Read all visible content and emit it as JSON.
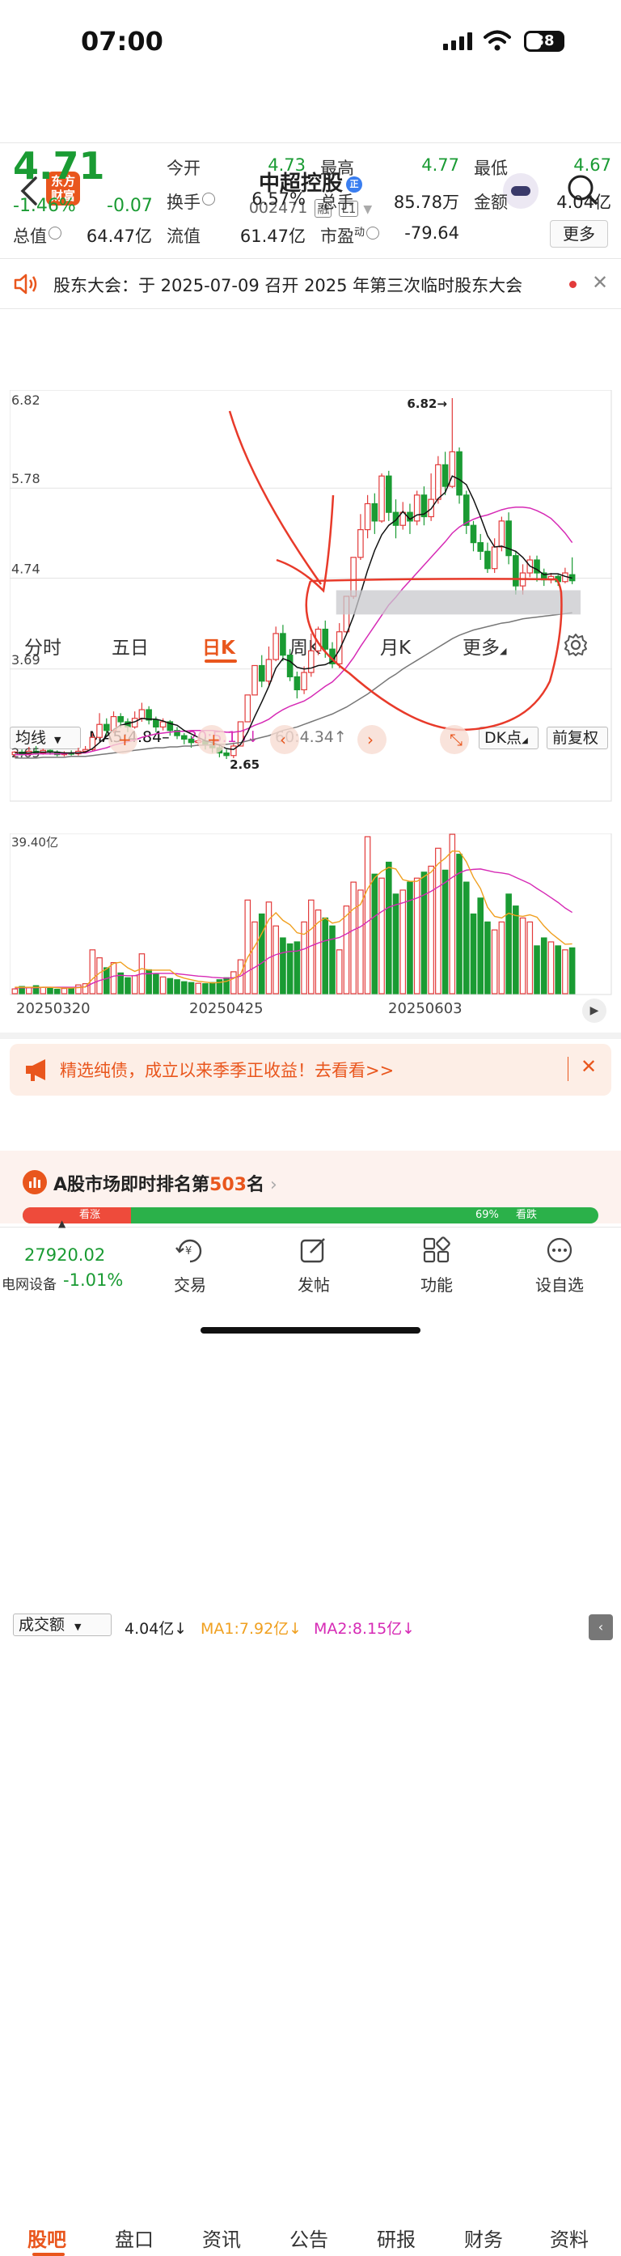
{
  "status_bar": {
    "time": "07:00",
    "battery": "38"
  },
  "header": {
    "logo_text": "东方财富",
    "title": "中超控股",
    "title_badge": "正",
    "code": "002471",
    "tags": [
      "融",
      "L1"
    ]
  },
  "quote": {
    "price": "4.71",
    "change_pct": "-1.46%",
    "change": "-0.07",
    "fields": {
      "open_label": "今开",
      "open": "4.73",
      "high_label": "最高",
      "high": "4.77",
      "low_label": "最低",
      "low": "4.67",
      "turnover_label": "换手",
      "turnover": "6.57%",
      "volume_label": "总手",
      "volume": "85.78万",
      "amount_label": "金额",
      "amount": "4.04亿",
      "mktcap_label": "总值",
      "mktcap": "64.47亿",
      "float_label": "流值",
      "float": "61.47亿",
      "pe_label": "市盈",
      "pe_sup": "动",
      "pe": "-79.64"
    },
    "more_button": "更多"
  },
  "notice": {
    "text": "股东大会：于 2025-07-09 召开 2025 年第三次临时股东大会"
  },
  "chart_tabs": [
    "分时",
    "五日",
    "日K",
    "周K",
    "月K",
    "更多"
  ],
  "active_chart_tab": "日K",
  "indicator_bar": {
    "selector": "均线",
    "ma5": "MA5:4.84–",
    "ma20": "20:5.15↓",
    "ma60": "60:4.34↑",
    "dk": "DK点",
    "adjust": "前复权"
  },
  "volume_bar": {
    "selector": "成交额",
    "value": "4.04亿↓",
    "ma1": "MA1:7.92亿↓",
    "ma2": "MA2:8.15亿↓"
  },
  "colors": {
    "up": "#e23b3b",
    "down": "#1a9b33",
    "accent": "#e9561d",
    "ma5": "#111111",
    "ma20": "#d62ab5",
    "ma60": "#777777",
    "vol_ma1": "#f0a020"
  },
  "chart_data": {
    "type": "candlestick",
    "y_ticks": [
      "6.82",
      "5.78",
      "4.74",
      "3.69",
      "2.65"
    ],
    "ylim": [
      2.65,
      6.82
    ],
    "high_marker": "6.82→",
    "low_marker": "2.65",
    "candles": [
      [
        2.7,
        2.73,
        2.67,
        2.74
      ],
      [
        2.73,
        2.71,
        2.68,
        2.76
      ],
      [
        2.71,
        2.74,
        2.69,
        2.79
      ],
      [
        2.74,
        2.72,
        2.7,
        2.8
      ],
      [
        2.72,
        2.75,
        2.7,
        2.77
      ],
      [
        2.75,
        2.73,
        2.7,
        2.76
      ],
      [
        2.73,
        2.7,
        2.68,
        2.75
      ],
      [
        2.7,
        2.72,
        2.68,
        2.74
      ],
      [
        2.72,
        2.71,
        2.69,
        2.75
      ],
      [
        2.71,
        2.74,
        2.69,
        2.78
      ],
      [
        2.74,
        2.76,
        2.72,
        2.8
      ],
      [
        2.76,
        2.9,
        2.74,
        2.95
      ],
      [
        2.9,
        3.05,
        2.88,
        3.18
      ],
      [
        3.05,
        2.98,
        2.92,
        3.12
      ],
      [
        2.98,
        3.14,
        2.95,
        3.2
      ],
      [
        3.14,
        3.08,
        3.01,
        3.18
      ],
      [
        3.08,
        3.02,
        2.96,
        3.12
      ],
      [
        3.02,
        3.12,
        3.0,
        3.2
      ],
      [
        3.12,
        3.22,
        3.08,
        3.3
      ],
      [
        3.22,
        3.1,
        3.05,
        3.26
      ],
      [
        3.1,
        3.02,
        2.96,
        3.14
      ],
      [
        3.02,
        3.08,
        2.98,
        3.12
      ],
      [
        3.08,
        2.98,
        2.92,
        3.1
      ],
      [
        2.98,
        2.92,
        2.88,
        3.02
      ],
      [
        2.92,
        2.88,
        2.82,
        2.95
      ],
      [
        2.88,
        2.84,
        2.78,
        2.92
      ],
      [
        2.84,
        2.86,
        2.8,
        2.9
      ],
      [
        2.86,
        2.82,
        2.76,
        2.9
      ],
      [
        2.82,
        2.78,
        2.72,
        2.86
      ],
      [
        2.78,
        2.72,
        2.67,
        2.82
      ],
      [
        2.72,
        2.69,
        2.65,
        2.76
      ],
      [
        2.69,
        2.8,
        2.66,
        2.84
      ],
      [
        2.8,
        3.08,
        2.8,
        3.08
      ],
      [
        3.08,
        3.39,
        3.08,
        3.39
      ],
      [
        3.39,
        3.73,
        3.39,
        3.73
      ],
      [
        3.73,
        3.55,
        3.48,
        3.85
      ],
      [
        3.55,
        3.8,
        3.5,
        3.95
      ],
      [
        3.8,
        4.1,
        3.78,
        4.18
      ],
      [
        4.1,
        3.85,
        3.78,
        4.2
      ],
      [
        3.85,
        3.6,
        3.55,
        3.92
      ],
      [
        3.6,
        3.45,
        3.35,
        3.66
      ],
      [
        3.45,
        3.65,
        3.4,
        3.72
      ],
      [
        3.65,
        3.9,
        3.6,
        4.1
      ],
      [
        3.9,
        4.15,
        3.85,
        4.18
      ],
      [
        4.15,
        3.92,
        3.82,
        4.25
      ],
      [
        3.92,
        3.75,
        3.7,
        4.0
      ],
      [
        3.75,
        4.12,
        3.7,
        4.22
      ],
      [
        4.12,
        4.53,
        4.1,
        4.53
      ],
      [
        4.53,
        4.98,
        4.5,
        4.98
      ],
      [
        4.98,
        5.3,
        4.95,
        5.48
      ],
      [
        5.3,
        5.6,
        5.2,
        5.7
      ],
      [
        5.6,
        5.4,
        5.25,
        5.72
      ],
      [
        5.4,
        5.92,
        5.38,
        5.95
      ],
      [
        5.92,
        5.5,
        5.4,
        5.98
      ],
      [
        5.5,
        5.35,
        5.2,
        5.65
      ],
      [
        5.35,
        5.5,
        5.3,
        5.62
      ],
      [
        5.5,
        5.4,
        5.25,
        5.6
      ],
      [
        5.4,
        5.7,
        5.35,
        5.75
      ],
      [
        5.7,
        5.45,
        5.35,
        5.8
      ],
      [
        5.45,
        5.65,
        5.4,
        5.95
      ],
      [
        5.65,
        6.05,
        5.6,
        6.15
      ],
      [
        6.05,
        5.8,
        5.7,
        6.2
      ],
      [
        5.8,
        6.2,
        5.78,
        6.82
      ],
      [
        6.2,
        5.7,
        5.6,
        6.25
      ],
      [
        5.7,
        5.35,
        5.25,
        5.75
      ],
      [
        5.35,
        5.15,
        5.05,
        5.4
      ],
      [
        5.15,
        5.05,
        4.95,
        5.25
      ],
      [
        5.05,
        4.85,
        4.8,
        5.15
      ],
      [
        4.85,
        5.1,
        4.8,
        5.2
      ],
      [
        5.1,
        5.4,
        5.05,
        5.45
      ],
      [
        5.4,
        5.0,
        4.9,
        5.5
      ],
      [
        5.0,
        4.65,
        4.55,
        5.05
      ],
      [
        4.65,
        4.8,
        4.55,
        4.9
      ],
      [
        4.8,
        4.95,
        4.75,
        5.0
      ],
      [
        4.95,
        4.8,
        4.7,
        5.0
      ],
      [
        4.8,
        4.72,
        4.65,
        4.85
      ],
      [
        4.72,
        4.76,
        4.68,
        4.8
      ],
      [
        4.76,
        4.7,
        4.65,
        4.78
      ],
      [
        4.7,
        4.8,
        4.68,
        4.86
      ],
      [
        4.78,
        4.71,
        4.67,
        4.98
      ]
    ],
    "ma5": [
      2.72,
      2.72,
      2.72,
      2.73,
      2.73,
      2.73,
      2.73,
      2.72,
      2.72,
      2.72,
      2.73,
      2.77,
      2.84,
      2.91,
      2.99,
      3.04,
      3.06,
      3.08,
      3.12,
      3.11,
      3.11,
      3.09,
      3.06,
      3.04,
      2.98,
      2.94,
      2.9,
      2.86,
      2.84,
      2.81,
      2.77,
      2.76,
      2.82,
      2.96,
      3.14,
      3.31,
      3.49,
      3.7,
      3.81,
      3.78,
      3.71,
      3.69,
      3.7,
      3.73,
      3.74,
      3.78,
      3.91,
      4.09,
      4.3,
      4.56,
      4.83,
      5.06,
      5.24,
      5.35,
      5.41,
      5.51,
      5.42,
      5.47,
      5.48,
      5.54,
      5.66,
      5.73,
      5.92,
      5.88,
      5.82,
      5.65,
      5.45,
      5.23,
      5.1,
      5.11,
      5.08,
      5.05,
      4.98,
      4.88,
      4.84,
      4.78,
      4.79,
      4.79,
      4.76,
      4.74
    ],
    "ma20": [
      2.7,
      2.7,
      2.7,
      2.71,
      2.71,
      2.71,
      2.71,
      2.71,
      2.72,
      2.72,
      2.72,
      2.74,
      2.76,
      2.78,
      2.81,
      2.83,
      2.85,
      2.87,
      2.9,
      2.92,
      2.94,
      2.95,
      2.96,
      2.97,
      2.97,
      2.98,
      2.98,
      2.98,
      2.98,
      2.97,
      2.96,
      2.96,
      2.97,
      3.0,
      3.04,
      3.07,
      3.11,
      3.17,
      3.22,
      3.26,
      3.29,
      3.32,
      3.37,
      3.43,
      3.49,
      3.54,
      3.62,
      3.71,
      3.82,
      3.95,
      4.07,
      4.19,
      4.31,
      4.43,
      4.52,
      4.62,
      4.71,
      4.8,
      4.89,
      4.98,
      5.07,
      5.16,
      5.26,
      5.33,
      5.38,
      5.42,
      5.45,
      5.47,
      5.5,
      5.53,
      5.55,
      5.56,
      5.56,
      5.55,
      5.52,
      5.48,
      5.43,
      5.35,
      5.26,
      5.15
    ],
    "ma60": [
      2.66,
      2.66,
      2.66,
      2.66,
      2.67,
      2.67,
      2.67,
      2.67,
      2.68,
      2.68,
      2.68,
      2.69,
      2.7,
      2.71,
      2.72,
      2.73,
      2.74,
      2.75,
      2.76,
      2.77,
      2.78,
      2.78,
      2.79,
      2.79,
      2.8,
      2.8,
      2.81,
      2.81,
      2.81,
      2.82,
      2.82,
      2.83,
      2.84,
      2.86,
      2.88,
      2.9,
      2.92,
      2.95,
      2.98,
      3.0,
      3.02,
      3.05,
      3.08,
      3.11,
      3.14,
      3.17,
      3.21,
      3.25,
      3.3,
      3.35,
      3.4,
      3.46,
      3.52,
      3.58,
      3.63,
      3.69,
      3.74,
      3.79,
      3.84,
      3.89,
      3.94,
      3.99,
      4.04,
      4.08,
      4.11,
      4.14,
      4.16,
      4.18,
      4.2,
      4.22,
      4.23,
      4.25,
      4.27,
      4.28,
      4.29,
      4.3,
      4.31,
      4.32,
      4.33,
      4.34
    ]
  },
  "volume_data": {
    "y_top": "39.40亿",
    "ylim": [
      0,
      39.4
    ],
    "values": [
      1.2,
      1.8,
      1.5,
      2.0,
      1.6,
      1.4,
      1.1,
      1.3,
      1.5,
      2.2,
      2.5,
      11.0,
      9.0,
      6.5,
      7.8,
      5.2,
      4.0,
      4.5,
      10.0,
      6.0,
      5.0,
      4.2,
      3.8,
      3.5,
      3.0,
      2.8,
      2.6,
      2.5,
      2.8,
      3.5,
      4.0,
      5.5,
      8.5,
      23.5,
      18.0,
      20.0,
      23.0,
      17.0,
      14.0,
      12.5,
      13.0,
      18.0,
      23.5,
      21.0,
      19.0,
      17.0,
      11.0,
      22.0,
      28.0,
      26.0,
      39.4,
      30.0,
      29.0,
      33.0,
      25.0,
      26.0,
      28.0,
      29.0,
      30.5,
      32.0,
      36.5,
      31.0,
      40.0,
      35.0,
      28.0,
      20.0,
      24.0,
      18.0,
      16.0,
      18.0,
      25.0,
      22.0,
      19.0,
      18.0,
      12.0,
      14.0,
      13.0,
      12.0,
      11.0,
      11.5
    ],
    "ma1": [
      1.6,
      1.6,
      1.6,
      1.6,
      1.6,
      1.6,
      1.5,
      1.4,
      1.4,
      1.5,
      1.7,
      3.7,
      5.2,
      6.2,
      7.6,
      7.9,
      6.5,
      5.6,
      6.3,
      5.9,
      5.9,
      5.9,
      5.9,
      4.5,
      3.9,
      3.5,
      3.1,
      2.9,
      2.7,
      2.8,
      3.1,
      3.8,
      4.9,
      9.1,
      11.9,
      15.1,
      18.6,
      20.3,
      18.4,
      17.3,
      15.3,
      14.9,
      16.2,
      17.9,
      19.0,
      17.7,
      18.1,
      19.6,
      21.3,
      22.4,
      26.3,
      29.1,
      30.7,
      31.7,
      31.3,
      28.6,
      28.2,
      28.2,
      29.4,
      30.5,
      32.6,
      34.0,
      35.8,
      35.7,
      33.1,
      29.2,
      26.4,
      21.7,
      19.4,
      19.0,
      20.2,
      19.6,
      19.4,
      19.8,
      19.2,
      17.0,
      15.2,
      13.8,
      12.4,
      12.5
    ],
    "ma2": [
      1.5,
      1.5,
      1.5,
      1.5,
      1.6,
      1.6,
      1.6,
      1.6,
      1.6,
      1.6,
      1.7,
      2.6,
      3.3,
      3.8,
      4.4,
      4.6,
      4.5,
      4.5,
      5.0,
      5.0,
      5.1,
      5.1,
      5.1,
      5.0,
      4.8,
      4.6,
      4.4,
      4.3,
      4.1,
      4.0,
      3.9,
      4.0,
      4.4,
      5.6,
      6.6,
      7.7,
      9.0,
      9.8,
      10.3,
      10.6,
      10.7,
      11.2,
      12.0,
      12.7,
      13.3,
      13.7,
      14.1,
      15.0,
      16.0,
      16.8,
      18.1,
      19.4,
      20.6,
      21.7,
      22.3,
      22.8,
      23.4,
      24.0,
      24.8,
      25.7,
      26.8,
      27.9,
      29.2,
      30.3,
      31.0,
      31.2,
      31.3,
      30.9,
      30.5,
      30.3,
      30.0,
      29.2,
      28.4,
      27.6,
      26.4,
      25.3,
      24.1,
      22.9,
      21.5,
      20.4
    ],
    "dates": [
      "20250320",
      "20250425",
      "20250603"
    ]
  },
  "promo": {
    "text": "精选纯债，成立以来季季正收益！去看看>>"
  },
  "bottom_tabs": [
    "股吧",
    "盘口",
    "资讯",
    "公告",
    "研报",
    "财务",
    "资料"
  ],
  "active_bottom_tab": "股吧",
  "rank": {
    "prefix": "A股市场即时排名第",
    "rank": "503",
    "suffix": "名",
    "left_badge": "看涨",
    "right_badge": "看跌",
    "right_pct": "69%"
  },
  "bottom_bar": {
    "index_value": "27920.02",
    "index_name": "电网设备",
    "index_change": "-1.01%",
    "items": [
      "交易",
      "发帖",
      "功能",
      "设自选"
    ]
  }
}
